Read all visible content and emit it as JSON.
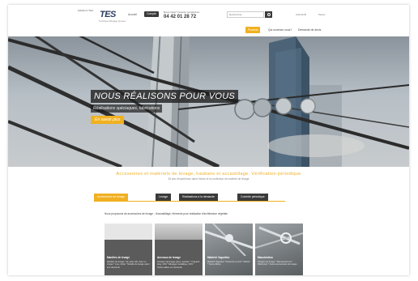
{
  "header": {
    "tagline": "MADE IN TES",
    "logo": "TES",
    "logo_sub": "Techniques Élingage Services",
    "links": [
      "Accueil"
    ],
    "account_button": "Compte",
    "phone_label": "Besoin d'aide? Contactez par téléphone",
    "phone": "04 42 01 28 72",
    "search_placeholder": "Rechercher...",
    "util_links": [
      "0,00 EUR",
      "Panier"
    ]
  },
  "nav": {
    "items": [
      "Produits",
      "Qui sommes nous?",
      "Demande de devis"
    ]
  },
  "hero": {
    "title": "NOUS RÉALISONS POUR VOUS",
    "subtitle": "Réalisations spéciaques, fabrications",
    "cta": "En savoir plus"
  },
  "section": {
    "title": "Accessoires et matériels de levage, haubans et accastillage. Vérification périodique",
    "subtitle": "35 ans d'expérience dans l'étude et la confection de matériel de levage",
    "tabs": [
      "Accessoires de levage",
      "Levage",
      "Réalisations à la demande",
      "Contrôle périodique"
    ],
    "active_tab": 0,
    "intro": "Nous proposons de accessoires de levage , d'accastillage, éléments pour réalisation d'architecture végétale"
  },
  "cards": [
    {
      "title": "Manilles de levage",
      "desc": "Manilles de levage  * En acier HR, avec ou zingué  * Lyre, droite  * Manille de levage selon leur demande",
      "image": "light"
    },
    {
      "title": "Anneaux de levage",
      "desc": "Anneaux de levage pylon, épaules  * Crapaud, lang, CNS  * Élingage métallique, CNS  * Toutes tailles sur demande",
      "image": "plain"
    },
    {
      "title": "Matériel Vagrettes",
      "desc": "Matériel Vagrettes  * Embouts à sertir  * Ridoirs  * Serre-câbles",
      "image": "photo"
    },
    {
      "title": "Manutention",
      "desc": "Sangles de levage  * Manutentionnel  * Palonniers  * Autres accessoires de levage",
      "image": "photo"
    }
  ],
  "colors": {
    "accent": "#f0b020",
    "dark": "#3a3a3a"
  }
}
